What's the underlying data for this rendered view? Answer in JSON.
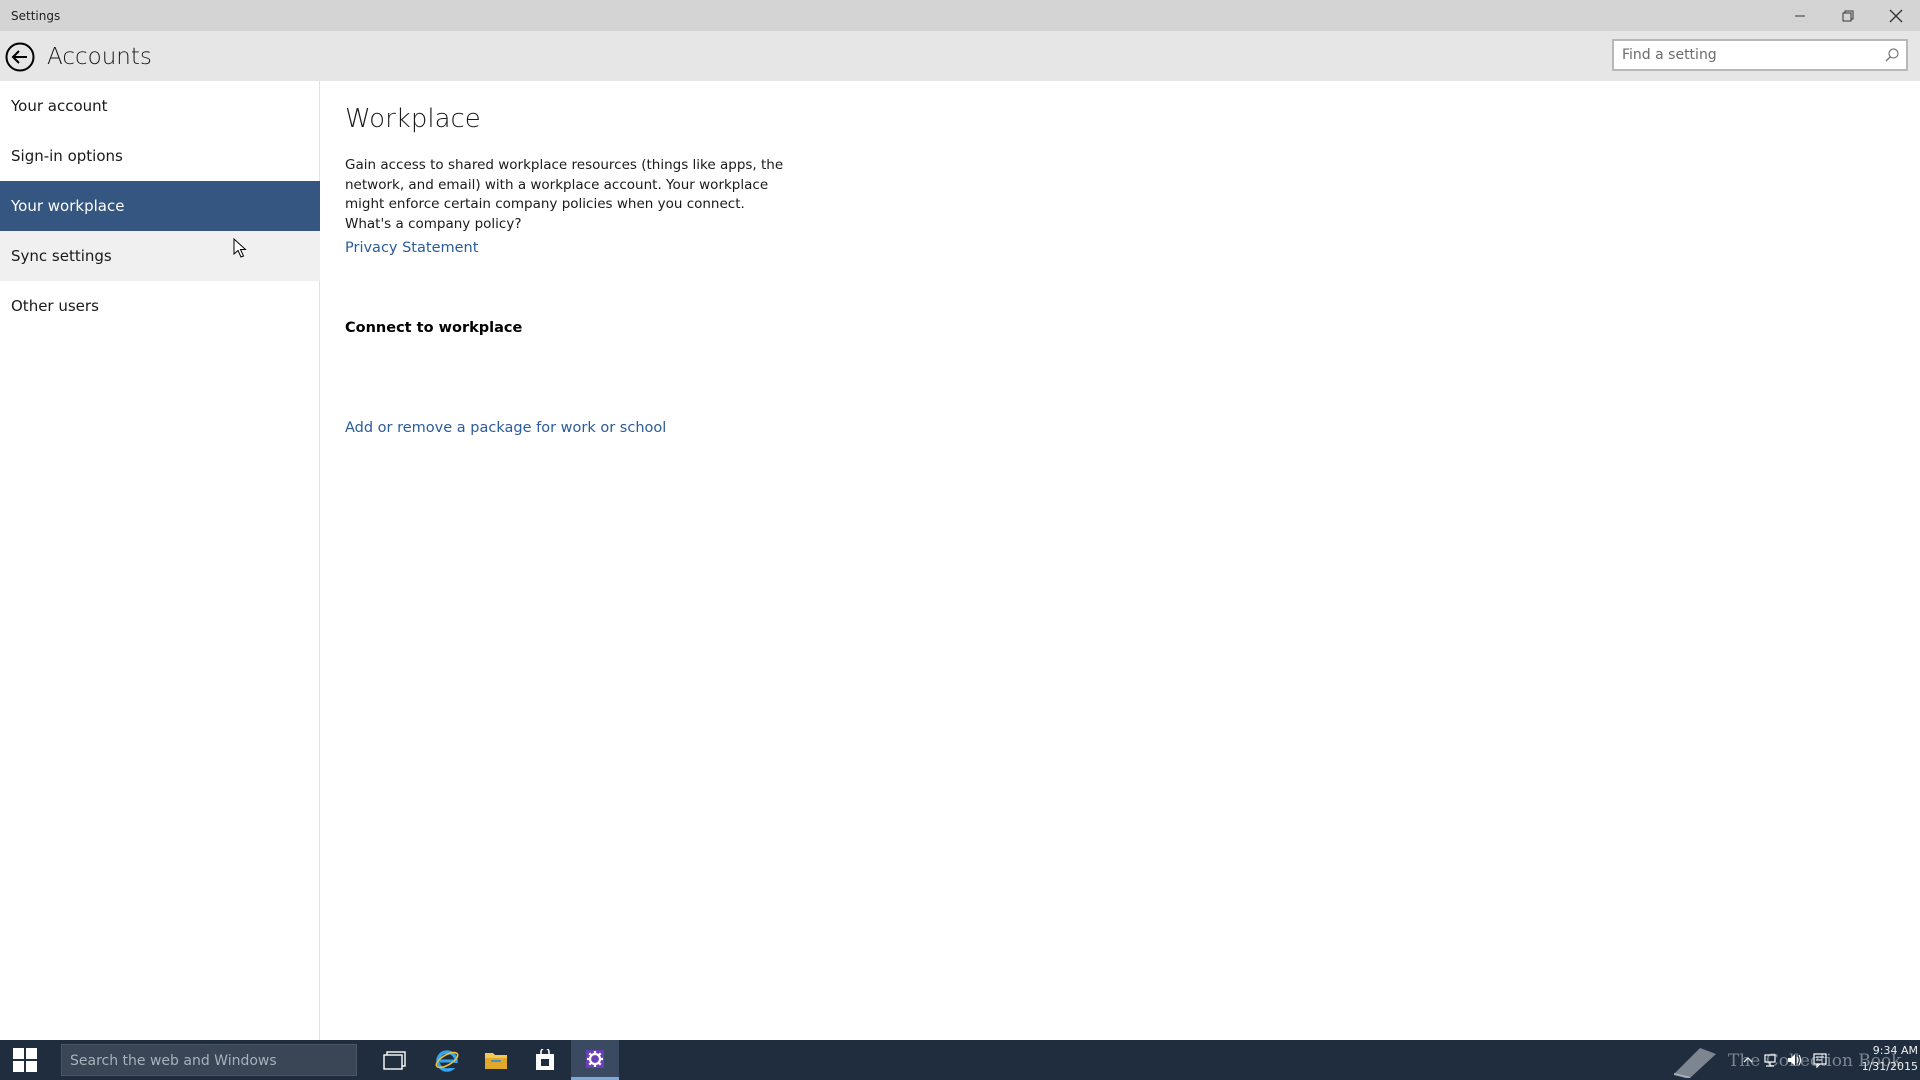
{
  "window": {
    "title": "Settings"
  },
  "header": {
    "title": "Accounts",
    "search_placeholder": "Find a setting"
  },
  "sidebar": {
    "items": [
      {
        "label": "Your account",
        "state": "normal"
      },
      {
        "label": "Sign-in options",
        "state": "normal"
      },
      {
        "label": "Your workplace",
        "state": "selected"
      },
      {
        "label": "Sync settings",
        "state": "hover"
      },
      {
        "label": "Other users",
        "state": "normal"
      }
    ]
  },
  "main": {
    "title": "Workplace",
    "description": "Gain access to shared workplace resources (things like apps, the network, and email) with a workplace account. Your workplace might enforce certain company policies when you connect. What's a company policy?",
    "privacy_link": "Privacy Statement",
    "connect_label": "Connect to workplace",
    "package_link": "Add or remove a package for work or school"
  },
  "taskbar": {
    "search_placeholder": "Search the web and Windows",
    "watermark": "The Collection Book",
    "time": "9:34 AM",
    "date": "1/31/2015"
  },
  "colors": {
    "accent": "#345680",
    "link": "#2a5c9a",
    "taskbar": "#1f2d3f"
  }
}
